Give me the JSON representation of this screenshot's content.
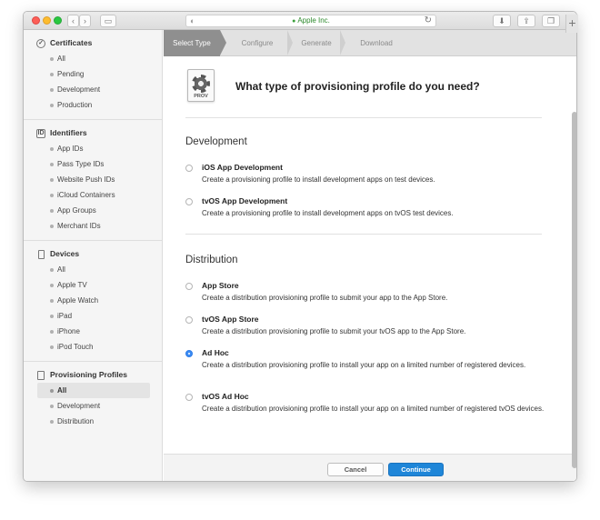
{
  "browser": {
    "address": "Apple Inc.",
    "tab_plus": "+"
  },
  "sidebar": {
    "sections": [
      {
        "title": "Certificates",
        "icon": "certificate-icon",
        "items": [
          "All",
          "Pending",
          "Development",
          "Production"
        ]
      },
      {
        "title": "Identifiers",
        "icon": "id-card-icon",
        "items": [
          "App IDs",
          "Pass Type IDs",
          "Website Push IDs",
          "iCloud Containers",
          "App Groups",
          "Merchant IDs"
        ]
      },
      {
        "title": "Devices",
        "icon": "device-icon",
        "items": [
          "All",
          "Apple TV",
          "Apple Watch",
          "iPad",
          "iPhone",
          "iPod Touch"
        ]
      },
      {
        "title": "Provisioning Profiles",
        "icon": "document-icon",
        "items": [
          "All",
          "Development",
          "Distribution"
        ],
        "active_index": 0
      }
    ]
  },
  "steps": [
    "Select Type",
    "Configure",
    "Generate",
    "Download"
  ],
  "main": {
    "icon_label": "PROV",
    "question": "What type of provisioning profile do you need?",
    "development": {
      "title": "Development",
      "options": [
        {
          "title": "iOS App Development",
          "desc": "Create a provisioning profile to install development apps on test devices."
        },
        {
          "title": "tvOS App Development",
          "desc": "Create a provisioning profile to install development apps on tvOS test devices."
        }
      ]
    },
    "distribution": {
      "title": "Distribution",
      "options": [
        {
          "title": "App Store",
          "desc": "Create a distribution provisioning profile to submit your app to the App Store."
        },
        {
          "title": "tvOS App Store",
          "desc": "Create a distribution provisioning profile to submit your tvOS app to the App Store."
        },
        {
          "title": "Ad Hoc",
          "desc": "Create a distribution provisioning profile to install your app on a limited number of registered devices.",
          "selected": true
        },
        {
          "title": "tvOS Ad Hoc",
          "desc": "Create a distribution provisioning profile to install your app on a limited number of registered tvOS devices."
        }
      ]
    }
  },
  "footer": {
    "cancel": "Cancel",
    "continue": "Continue"
  },
  "colors": {
    "accent": "#1f86d8",
    "active_step": "#8f8f8f"
  }
}
